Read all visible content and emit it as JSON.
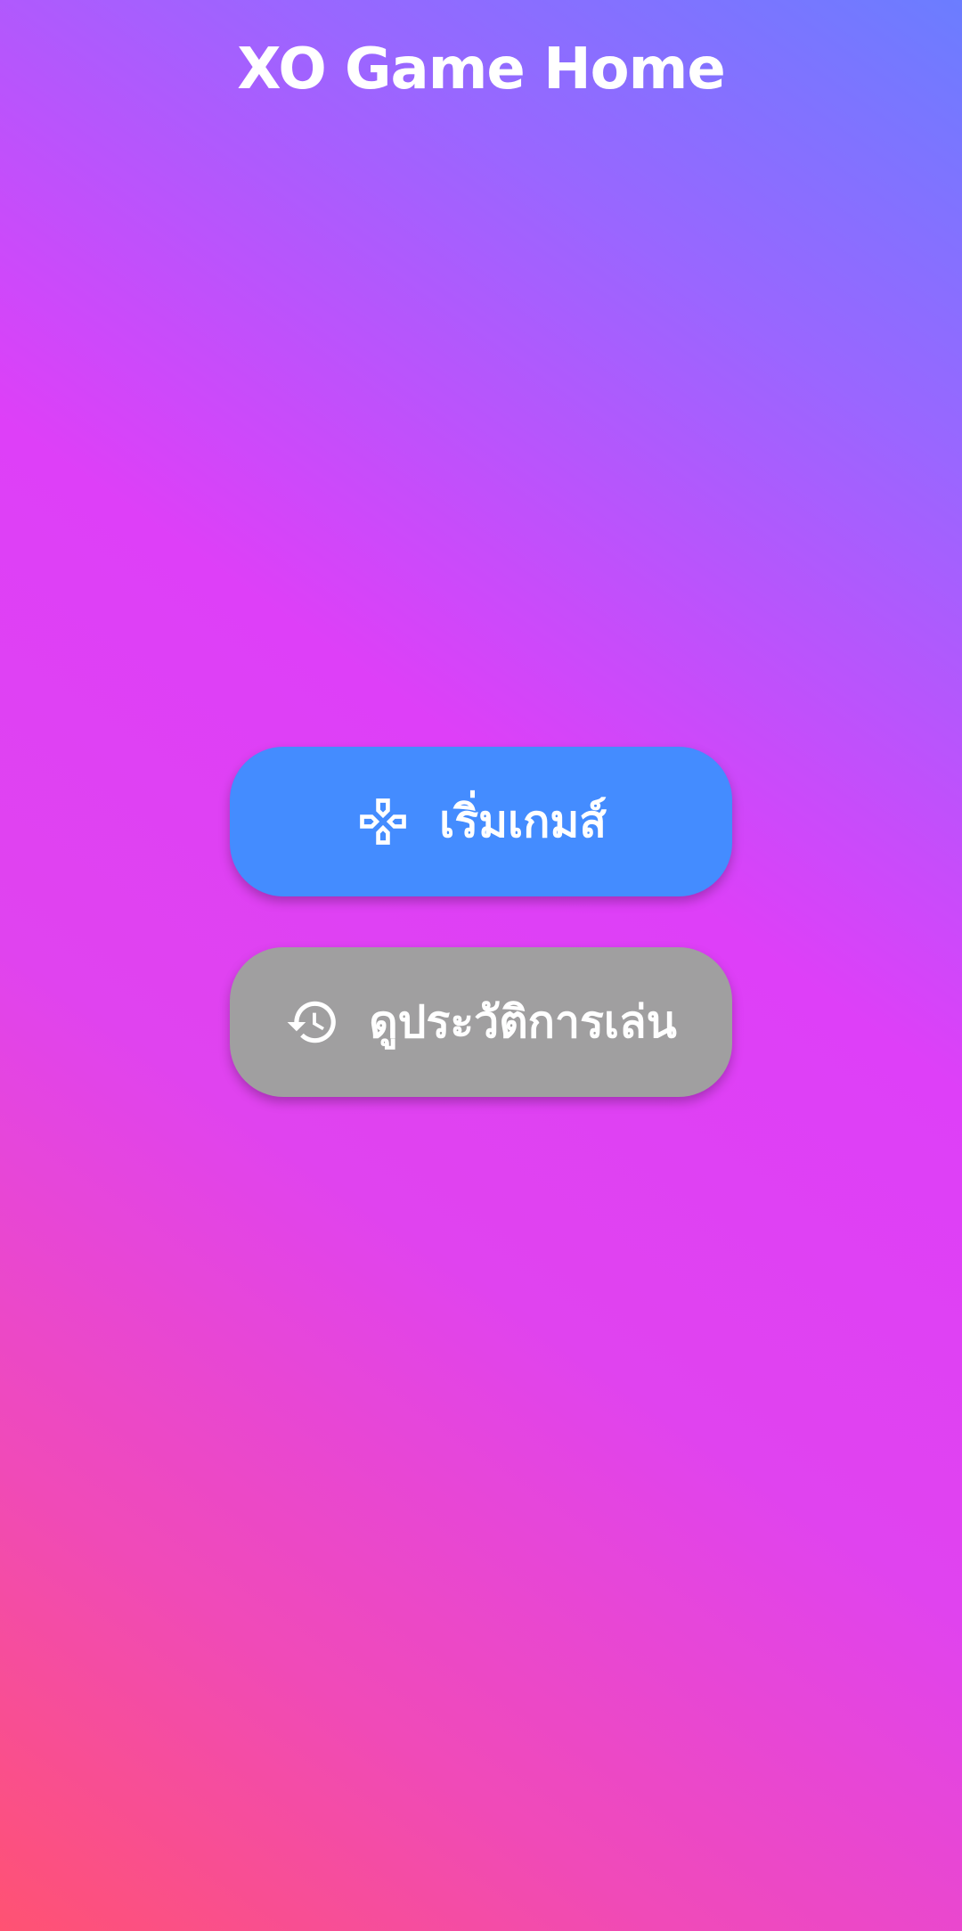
{
  "header": {
    "title": "XO Game Home"
  },
  "menu": {
    "start_button": {
      "label": "เริ่มเกมส์",
      "icon": "gamepad-icon",
      "color": "#448cff"
    },
    "history_button": {
      "label": "ดูประวัติการเล่น",
      "icon": "history-icon",
      "color": "#a09fa0"
    }
  },
  "colors": {
    "gradient_top_right": "#6b7dff",
    "gradient_middle": "#de3ff8",
    "gradient_bottom_left": "#ff5272",
    "text": "#ffffff"
  }
}
